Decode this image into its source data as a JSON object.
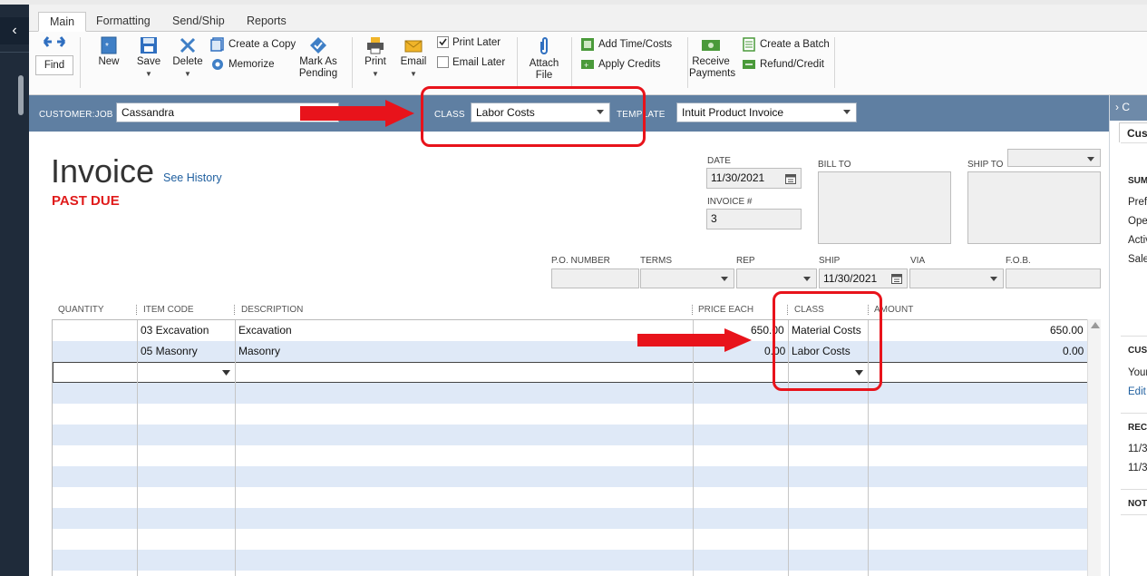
{
  "tabs": [
    "Main",
    "Formatting",
    "Send/Ship",
    "Reports"
  ],
  "toolbar": {
    "find": "Find",
    "new": "New",
    "save": "Save",
    "delete": "Delete",
    "create_copy": "Create a Copy",
    "memorize": "Memorize",
    "mark_as_pending_1": "Mark As",
    "mark_as_pending_2": "Pending",
    "print": "Print",
    "email": "Email",
    "print_later": "Print Later",
    "email_later": "Email Later",
    "attach_file_1": "Attach",
    "attach_file_2": "File",
    "add_time_costs": "Add Time/Costs",
    "apply_credits": "Apply Credits",
    "receive_payments_1": "Receive",
    "receive_payments_2": "Payments",
    "create_batch": "Create a Batch",
    "refund_credit": "Refund/Credit"
  },
  "header": {
    "customer_label": "CUSTOMER:JOB",
    "customer_value": "Cassandra",
    "class_label": "CLASS",
    "class_value": "Labor Costs",
    "template_label": "TEMPLATE",
    "template_value": "Intuit Product Invoice"
  },
  "form": {
    "title": "Invoice",
    "see_history": "See History",
    "past_due": "PAST DUE",
    "date_label": "DATE",
    "date_value": "11/30/2021",
    "invoice_label": "INVOICE #",
    "invoice_value": "3",
    "bill_to_label": "BILL TO",
    "ship_to_label": "SHIP TO",
    "po_label": "P.O. NUMBER",
    "terms_label": "TERMS",
    "rep_label": "REP",
    "ship_label": "SHIP",
    "ship_value": "11/30/2021",
    "via_label": "VIA",
    "fob_label": "F.O.B."
  },
  "table": {
    "columns": [
      "QUANTITY",
      "ITEM CODE",
      "DESCRIPTION",
      "PRICE EACH",
      "CLASS",
      "AMOUNT"
    ],
    "rows": [
      {
        "item": "03 Excavation",
        "description": "Excavation",
        "price": "650.00",
        "class": "Material Costs",
        "amount": "650.00"
      },
      {
        "item": "05 Masonry",
        "description": "Masonry",
        "price": "0.00",
        "class": "Labor Costs",
        "amount": "0.00"
      }
    ]
  },
  "right_panel": {
    "header": "C",
    "tab": "Cus",
    "summary": "SUM",
    "lines": [
      "Pref",
      "Ope",
      "Activ",
      "Sale"
    ],
    "customer_hdr": "CUS",
    "your": "Your",
    "edit": "Edit",
    "recent": "RECI",
    "recent_1": "11/3",
    "recent_2": "11/3",
    "notes": "NOT"
  },
  "colors": {
    "band": "#5f7fa2",
    "annotation_red": "#e8131b",
    "past_due": "#e01b1b",
    "row_alt": "#dfe9f7"
  }
}
